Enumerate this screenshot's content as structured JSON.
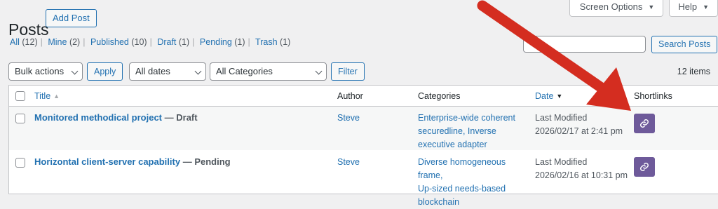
{
  "page": {
    "title": "Posts",
    "add_button": "Add Post",
    "screen_options": "Screen Options",
    "help": "Help"
  },
  "filters": [
    {
      "label": "All",
      "count": "(12)"
    },
    {
      "label": "Mine",
      "count": "(2)"
    },
    {
      "label": "Published",
      "count": "(10)"
    },
    {
      "label": "Draft",
      "count": "(1)"
    },
    {
      "label": "Pending",
      "count": "(1)"
    },
    {
      "label": "Trash",
      "count": "(1)"
    }
  ],
  "search": {
    "value": "",
    "button": "Search Posts"
  },
  "toolbar": {
    "bulk_actions": "Bulk actions",
    "apply": "Apply",
    "dates": "All dates",
    "categories": "All Categories",
    "filter": "Filter",
    "items_count": "12 items"
  },
  "columns": {
    "title": "Title",
    "author": "Author",
    "categories": "Categories",
    "date": "Date",
    "shortlinks": "Shortlinks"
  },
  "rows": [
    {
      "title": "Monitored methodical project",
      "state": "— Draft",
      "author": "Steve",
      "categories": [
        "Enterprise-wide coherent",
        "securedline",
        "Inverse",
        "executive adapter"
      ],
      "date_label": "Last Modified",
      "date_value": "2026/02/17 at 2:41 pm"
    },
    {
      "title": "Horizontal client-server capability",
      "state": "— Pending",
      "author": "Steve",
      "categories": [
        "Diverse homogeneous frame,",
        "Up-sized needs-based",
        "blockchain"
      ],
      "date_label": "Last Modified",
      "date_value": "2026/02/16 at 10:31 pm"
    }
  ],
  "colors": {
    "accent": "#2271b1",
    "shortlink": "#6e5a9a",
    "arrow": "#d42d20"
  },
  "icons": {
    "shortlink": "link-icon",
    "annotation": "red-arrow"
  }
}
